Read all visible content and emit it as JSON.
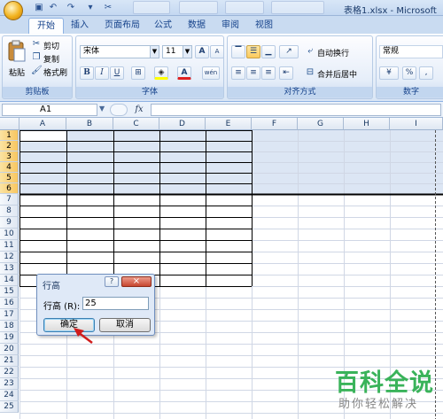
{
  "window": {
    "title": "表格1.xlsx - Microsoft"
  },
  "tabs": [
    "开始",
    "插入",
    "页面布局",
    "公式",
    "数据",
    "审阅",
    "视图"
  ],
  "clipboard": {
    "paste": "粘贴",
    "cut": "剪切",
    "copy": "复制",
    "format_painter": "格式刷",
    "group_label": "剪贴板"
  },
  "font": {
    "name": "宋体",
    "size": "11",
    "grow": "A",
    "shrink": "A",
    "bold": "B",
    "italic": "I",
    "underline": "U",
    "font_color": "A",
    "pinyin": "wén",
    "group_label": "字体"
  },
  "alignment": {
    "wrap_text": "自动换行",
    "merge_center": "合并后居中",
    "group_label": "对齐方式"
  },
  "number": {
    "format": "常规",
    "percent": "%",
    "comma": ",",
    "group_label": "数字"
  },
  "formula_bar": {
    "name_box": "A1",
    "fx": "fx",
    "value": ""
  },
  "columns": [
    "A",
    "B",
    "C",
    "D",
    "E",
    "F",
    "G",
    "H",
    "I"
  ],
  "rows": [
    "1",
    "2",
    "3",
    "4",
    "5",
    "6",
    "7",
    "8",
    "9",
    "10",
    "11",
    "12",
    "13",
    "14",
    "15",
    "16",
    "17",
    "18",
    "19",
    "20",
    "21",
    "22",
    "23",
    "24",
    "25"
  ],
  "dialog": {
    "title": "行高",
    "help": "?",
    "close": "×",
    "label": "行高 (R):",
    "value": "25",
    "ok": "确定",
    "cancel": "取消"
  },
  "watermark": {
    "brand": "百科全说",
    "slogan": "助你轻松解决"
  },
  "colors": {
    "selection": "#dce6f4",
    "header_selected": "#f8c660",
    "watermark": "#3ab35a",
    "dialog_bg": "#dfe9f7",
    "arrow": "#d01c1c"
  }
}
